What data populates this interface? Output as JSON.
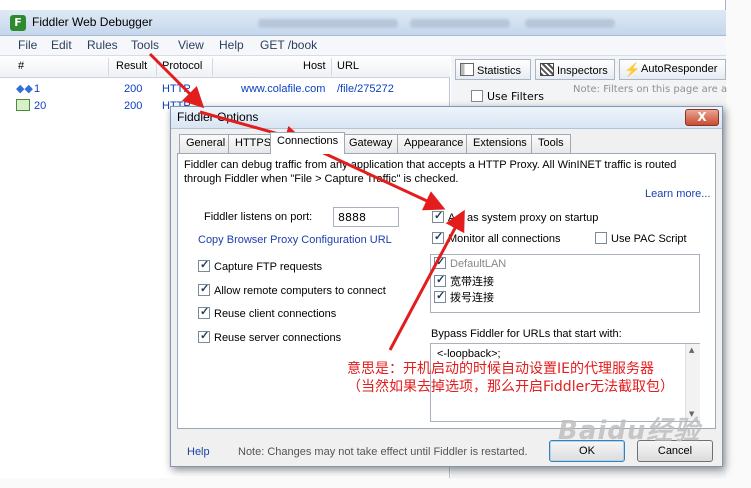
{
  "app": {
    "title": "Fiddler Web Debugger",
    "icon": "fiddler-logo-icon"
  },
  "menu": {
    "items": [
      "File",
      "Edit",
      "Rules",
      "Tools",
      "View",
      "Help",
      "GET /book"
    ]
  },
  "session_list": {
    "columns": [
      "#",
      "Result",
      "Protocol",
      "Host",
      "URL"
    ],
    "rows": [
      {
        "id": "1",
        "result": "200",
        "protocol": "HTTP",
        "host": "www.colafile.com",
        "url": "/file/275272",
        "icon": "get-request-icon"
      },
      {
        "id": "20",
        "result": "200",
        "protocol": "HTTP",
        "host": "",
        "url": "",
        "icon": "response-image-icon"
      }
    ]
  },
  "right_pane": {
    "tabs": [
      {
        "label": "Statistics",
        "icon": "statistics-icon"
      },
      {
        "label": "Inspectors",
        "icon": "inspectors-icon"
      },
      {
        "label": "AutoResponder",
        "icon": "lightning-icon"
      }
    ],
    "use_filters_label": "Use Filters",
    "use_filters_checked": false,
    "filters_note": "Note: Filters on this page are a"
  },
  "dialog": {
    "title": "Fiddler Options",
    "close_label": "X",
    "tabs": [
      "General",
      "HTTPS",
      "Connections",
      "Gateway",
      "Appearance",
      "Extensions",
      "Tools"
    ],
    "active_tab": "Connections",
    "intro_line1": "Fiddler can debug traffic from any application that accepts a HTTP Proxy. All WinINET traffic is routed",
    "intro_line2": "through Fiddler when \"File > Capture Traffic\" is checked.",
    "learn_more": "Learn more...",
    "port_label": "Fiddler listens on port:",
    "port_value": "8888",
    "copy_proxy_link": "Copy Browser Proxy Configuration URL",
    "left_options": [
      {
        "label": "Capture FTP requests",
        "checked": true
      },
      {
        "label": "Allow remote computers to connect",
        "checked": true
      },
      {
        "label": "Reuse client connections",
        "checked": true
      },
      {
        "label": "Reuse server connections",
        "checked": true
      }
    ],
    "act_as_proxy": {
      "label": "Act as system proxy on startup",
      "checked": true
    },
    "monitor_all": {
      "label": "Monitor all connections",
      "checked": true
    },
    "use_pac": {
      "label": "Use PAC Script",
      "checked": false
    },
    "connections": [
      {
        "label": "DefaultLAN",
        "checked": true
      },
      {
        "label": "宽带连接",
        "checked": true
      },
      {
        "label": "拨号连接",
        "checked": true
      }
    ],
    "bypass_label": "Bypass Fiddler for URLs that start with:",
    "bypass_value": "<-loopback>;",
    "help": "Help",
    "footer_note": "Note: Changes may not take effect until Fiddler is restarted.",
    "ok": "OK",
    "cancel": "Cancel"
  },
  "annotation": {
    "line1": "意思是：开机启动的时候自动设置IE的代理服务器",
    "line2": "（当然如果去掉选项，那么开启Fiddler无法截取包）",
    "color": "#e31d1d"
  },
  "watermark": "Baidu经验"
}
